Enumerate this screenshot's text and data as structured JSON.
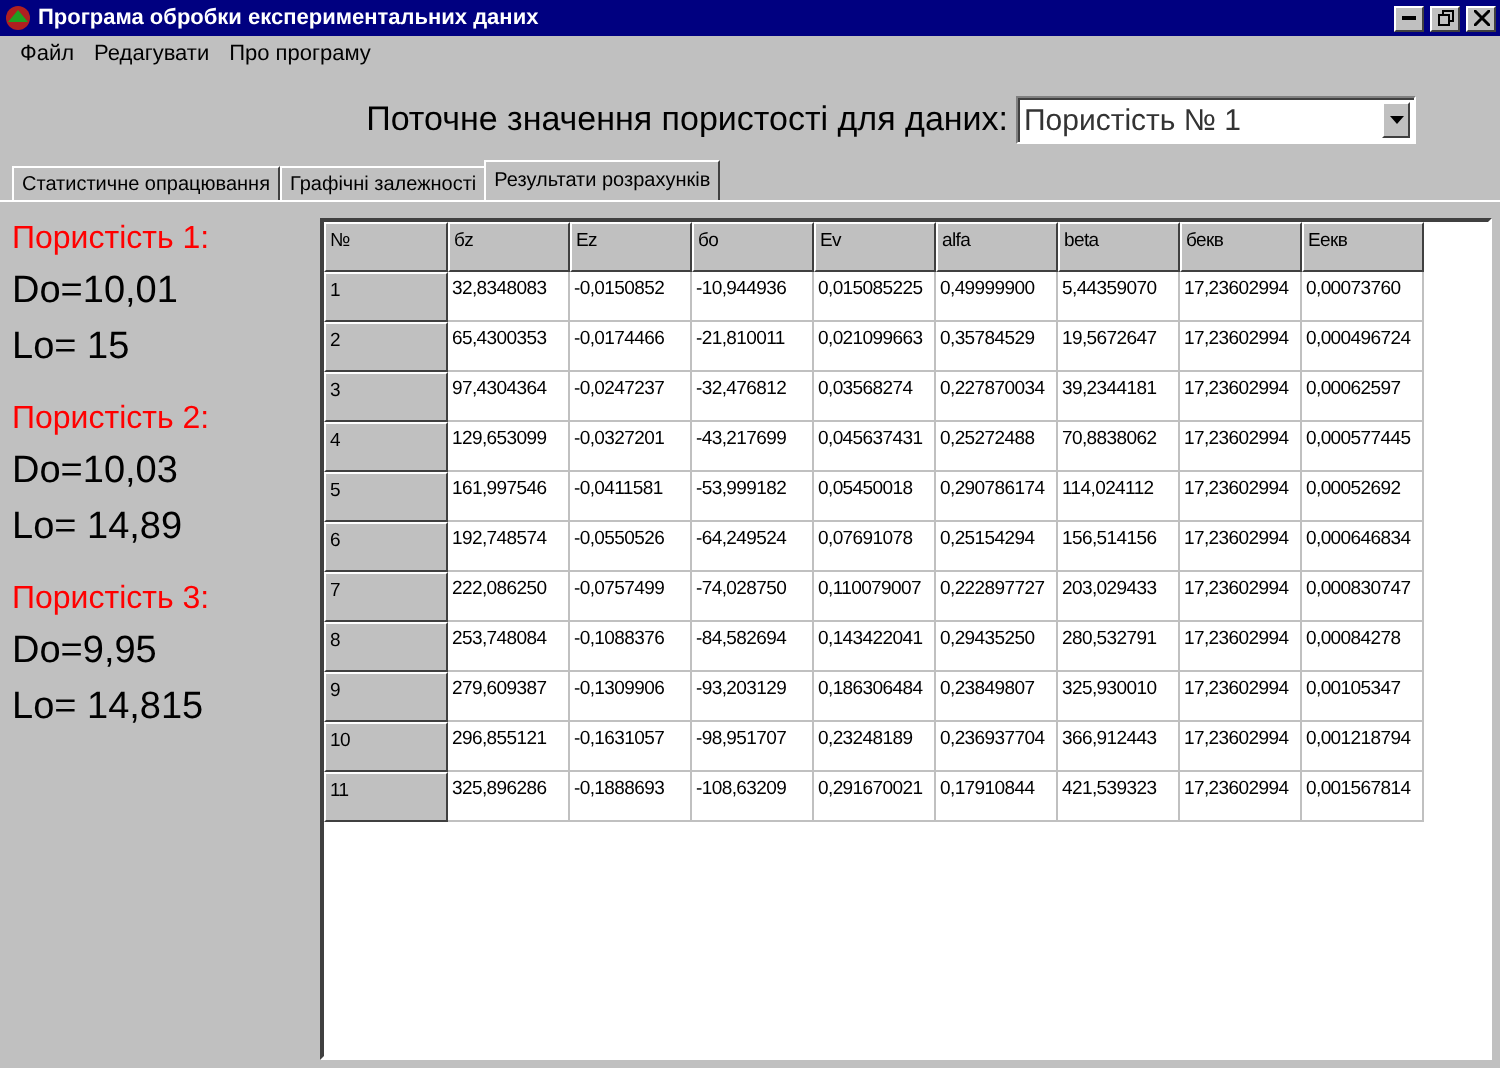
{
  "window": {
    "title": "Програма обробки експериментальних даних"
  },
  "menu": [
    "Файл",
    "Редагувати",
    "Про програму"
  ],
  "porosity_selector": {
    "label": "Поточне значення пористості для даних:",
    "value": "Пористість № 1"
  },
  "tabs": [
    {
      "label": "Статистичне опрацювання",
      "selected": false
    },
    {
      "label": "Графічні залежності",
      "selected": false
    },
    {
      "label": "Результати розрахунків",
      "selected": true
    }
  ],
  "porosities": [
    {
      "title": "Пористість 1:",
      "do": "Do=10,01",
      "lo": "Lo= 15"
    },
    {
      "title": "Пористість 2:",
      "do": "Do=10,03",
      "lo": "Lo= 14,89"
    },
    {
      "title": "Пористість 3:",
      "do": "Do=9,95",
      "lo": "Lo= 14,815"
    }
  ],
  "table": {
    "columns": [
      "№",
      "бz",
      "Ez",
      "бо",
      "Ev",
      "alfa",
      "beta",
      "бекв",
      "Еекв"
    ],
    "rows": [
      [
        "1",
        "32,8348083",
        "-0,0150852",
        "-10,944936",
        "0,015085225",
        "0,49999900",
        "5,44359070",
        "17,23602994",
        "0,00073760"
      ],
      [
        "2",
        "65,4300353",
        "-0,0174466",
        "-21,810011",
        "0,021099663",
        "0,35784529",
        "19,5672647",
        "17,23602994",
        "0,000496724"
      ],
      [
        "3",
        "97,4304364",
        "-0,0247237",
        "-32,476812",
        "0,03568274",
        "0,227870034",
        "39,2344181",
        "17,23602994",
        "0,00062597"
      ],
      [
        "4",
        "129,653099",
        "-0,0327201",
        "-43,217699",
        "0,045637431",
        "0,25272488",
        "70,8838062",
        "17,23602994",
        "0,000577445"
      ],
      [
        "5",
        "161,997546",
        "-0,0411581",
        "-53,999182",
        "0,05450018",
        "0,290786174",
        "114,024112",
        "17,23602994",
        "0,00052692"
      ],
      [
        "6",
        "192,748574",
        "-0,0550526",
        "-64,249524",
        "0,07691078",
        "0,25154294",
        "156,514156",
        "17,23602994",
        "0,000646834"
      ],
      [
        "7",
        "222,086250",
        "-0,0757499",
        "-74,028750",
        "0,110079007",
        "0,222897727",
        "203,029433",
        "17,23602994",
        "0,000830747"
      ],
      [
        "8",
        "253,748084",
        "-0,1088376",
        "-84,582694",
        "0,143422041",
        "0,29435250",
        "280,532791",
        "17,23602994",
        "0,00084278"
      ],
      [
        "9",
        "279,609387",
        "-0,1309906",
        "-93,203129",
        "0,186306484",
        "0,23849807",
        "325,930010",
        "17,23602994",
        "0,00105347"
      ],
      [
        "10",
        "296,855121",
        "-0,1631057",
        "-98,951707",
        "0,23248189",
        "0,236937704",
        "366,912443",
        "17,23602994",
        "0,001218794"
      ],
      [
        "11",
        "325,896286",
        "-0,1888693",
        "-108,63209",
        "0,291670021",
        "0,17910844",
        "421,539323",
        "17,23602994",
        "0,001567814"
      ]
    ]
  }
}
